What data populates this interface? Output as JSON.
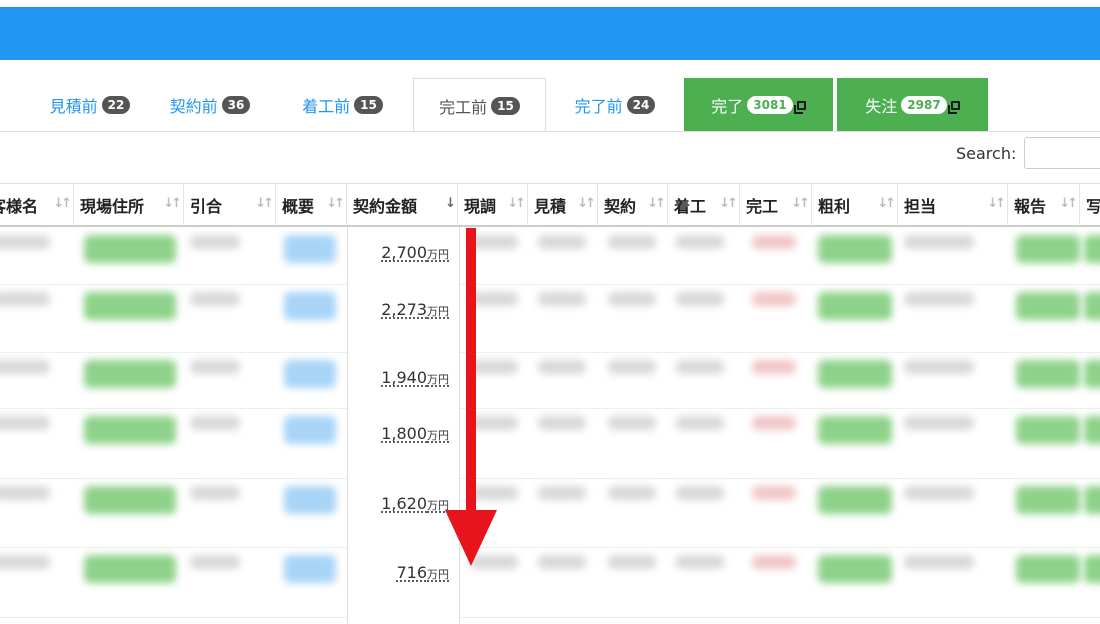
{
  "tabs": [
    {
      "label": "見積前",
      "count": "22",
      "state": "normal"
    },
    {
      "label": "契約前",
      "count": "36",
      "state": "normal"
    },
    {
      "label": "着工前",
      "count": "15",
      "state": "normal"
    },
    {
      "label": "完工前",
      "count": "15",
      "state": "active"
    },
    {
      "label": "完了前",
      "count": "24",
      "state": "normal"
    },
    {
      "label": "完了",
      "count": "3081",
      "state": "green",
      "icon": "external-link-icon"
    },
    {
      "label": "失注",
      "count": "2987",
      "state": "green",
      "icon": "external-link-icon"
    }
  ],
  "search": {
    "label": "Search:",
    "value": ""
  },
  "columns": [
    "客様名",
    "現場住所",
    "引合",
    "概要",
    "契約金額",
    "現調",
    "見積",
    "契約",
    "着工",
    "完工",
    "粗利",
    "担当",
    "報告",
    "写"
  ],
  "amounts": [
    {
      "value": "2,700",
      "unit": "万円"
    },
    {
      "value": "2,273",
      "unit": "万円"
    },
    {
      "value": "1,940",
      "unit": "万円"
    },
    {
      "value": "1,800",
      "unit": "万円"
    },
    {
      "value": "1,620",
      "unit": "万円"
    },
    {
      "value": "716",
      "unit": "万円"
    }
  ],
  "colors": {
    "header_blue": "#2196f3",
    "green": "#4caf50",
    "arrow": "#e8141b"
  }
}
